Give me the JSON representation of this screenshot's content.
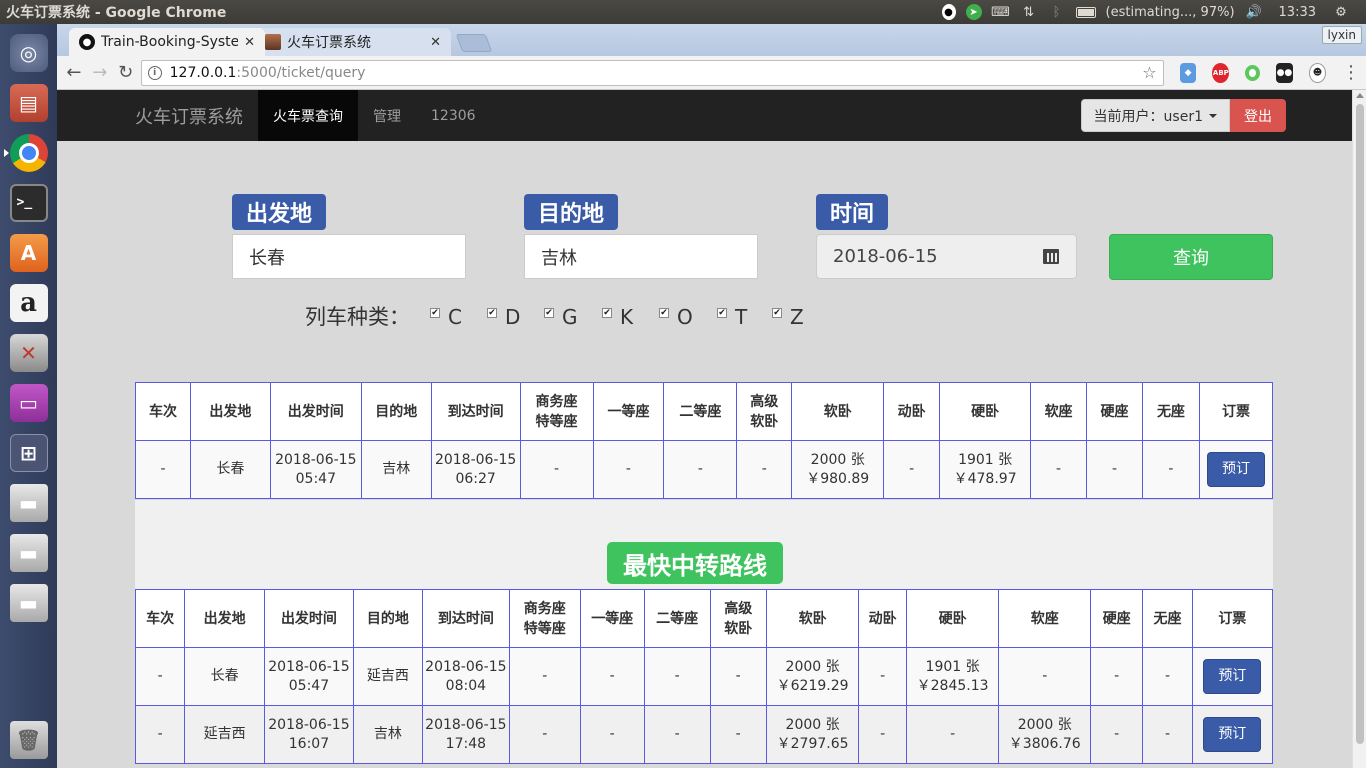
{
  "os": {
    "window_title": "火车订票系统 - Google Chrome",
    "battery_text": "(estimating..., 97%)",
    "clock": "13:33"
  },
  "browser": {
    "tabs": [
      {
        "label": "Train-Booking-Syste",
        "favicon": "github-icon",
        "active": true
      },
      {
        "label": "火车订票系统",
        "favicon": "page-icon",
        "active": false
      }
    ],
    "profile_name": "lyxin",
    "url_host": "127.0.0.1",
    "url_rest": ":5000/ticket/query"
  },
  "navbar": {
    "brand": "火车订票系统",
    "links": [
      "火车票查询",
      "管理",
      "12306"
    ],
    "user_label": "当前用户：user1",
    "logout_label": "登出"
  },
  "search": {
    "from_label": "出发地",
    "from_value": "长春",
    "to_label": "目的地",
    "to_value": "吉林",
    "date_label": "时间",
    "date_value": "2018-06-15",
    "query_label": "查询",
    "type_label": "列车种类：",
    "train_types": [
      "C",
      "D",
      "G",
      "K",
      "O",
      "T",
      "Z"
    ]
  },
  "direct_table": {
    "headers": [
      "车次",
      "出发地",
      "出发时间",
      "目的地",
      "到达时间",
      "商务座\n特等座",
      "一等座",
      "二等座",
      "高级\n软卧",
      "软卧",
      "动卧",
      "硬卧",
      "软座",
      "硬座",
      "无座",
      "订票"
    ],
    "rows": [
      [
        "-",
        "长春",
        "2018-06-15\n05:47",
        "吉林",
        "2018-06-15\n06:27",
        "-",
        "-",
        "-",
        "-",
        "2000 张\n￥980.89",
        "-",
        "1901 张\n￥478.97",
        "-",
        "-",
        "-",
        "预订"
      ]
    ]
  },
  "transfer": {
    "title": "最快中转路线"
  },
  "transfer_table": {
    "headers": [
      "车次",
      "出发地",
      "出发时间",
      "目的地",
      "到达时间",
      "商务座\n特等座",
      "一等座",
      "二等座",
      "高级\n软卧",
      "软卧",
      "动卧",
      "硬卧",
      "软座",
      "硬座",
      "无座",
      "订票"
    ],
    "rows": [
      [
        "-",
        "长春",
        "2018-06-15\n05:47",
        "延吉西",
        "2018-06-15\n08:04",
        "-",
        "-",
        "-",
        "-",
        "2000 张\n￥6219.29",
        "-",
        "1901 张\n￥2845.13",
        "-",
        "-",
        "-",
        "预订"
      ],
      [
        "-",
        "延吉西",
        "2018-06-15\n16:07",
        "吉林",
        "2018-06-15\n17:48",
        "-",
        "-",
        "-",
        "-",
        "2000 张\n￥2797.65",
        "-",
        "-",
        "2000 张\n￥3806.76",
        "-",
        "-",
        "预订"
      ]
    ]
  }
}
